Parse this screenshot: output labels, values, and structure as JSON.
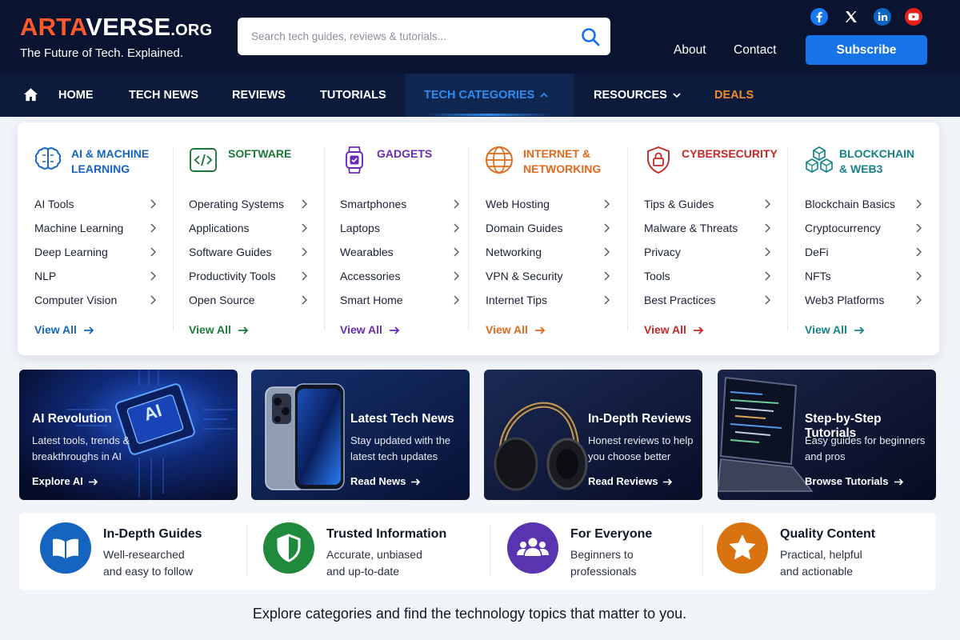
{
  "brand": {
    "name_part1": "ARTA",
    "name_part2": "VERSE",
    "name_suffix": ".ORG",
    "tagline": "The Future of Tech. Explained."
  },
  "search": {
    "placeholder": "Search tech guides, reviews & tutorials..."
  },
  "social": [
    "facebook-icon",
    "x-icon",
    "linkedin-icon",
    "youtube-icon"
  ],
  "header_links": {
    "about": "About",
    "contact": "Contact",
    "subscribe": "Subscribe"
  },
  "nav": {
    "home": "HOME",
    "tech_news": "TECH NEWS",
    "reviews": "REVIEWS",
    "tutorials": "TUTORIALS",
    "tech_categories": "TECH CATEGORIES",
    "resources": "RESOURCES",
    "deals": "DEALS"
  },
  "categories": [
    {
      "title_line1": "AI & MACHINE",
      "title_line2": "LEARNING",
      "color": "#1565c0",
      "items": [
        "AI Tools",
        "Machine Learning",
        "Deep Learning",
        "NLP",
        "Computer Vision"
      ],
      "view_all": "View All"
    },
    {
      "title_line1": "SOFTWARE",
      "title_line2": "",
      "color": "#1b7a3a",
      "items": [
        "Operating Systems",
        "Applications",
        "Software Guides",
        "Productivity Tools",
        "Open Source"
      ],
      "view_all": "View All"
    },
    {
      "title_line1": "GADGETS",
      "title_line2": "",
      "color": "#6a2bb8",
      "items": [
        "Smartphones",
        "Laptops",
        "Wearables",
        "Accessories",
        "Smart Home"
      ],
      "view_all": "View All"
    },
    {
      "title_line1": "INTERNET &",
      "title_line2": "NETWORKING",
      "color": "#e06a1b",
      "items": [
        "Web Hosting",
        "Domain Guides",
        "Networking",
        "VPN & Security",
        "Internet Tips"
      ],
      "view_all": "View All"
    },
    {
      "title_line1": "CYBERSECURITY",
      "title_line2": "",
      "color": "#c62828",
      "items": [
        "Tips & Guides",
        "Malware & Threats",
        "Privacy",
        "Tools",
        "Best Practices"
      ],
      "view_all": "View All"
    },
    {
      "title_line1": "BLOCKCHAIN",
      "title_line2": "& WEB3",
      "color": "#16838a",
      "items": [
        "Blockchain Basics",
        "Cryptocurrency",
        "DeFi",
        "NFTs",
        "Web3 Platforms"
      ],
      "view_all": "View All"
    }
  ],
  "cards": [
    {
      "title": "AI Revolution",
      "desc_line1": "Latest tools, trends &",
      "desc_line2": "breakthroughs in AI",
      "link": "Explore AI",
      "badge": "AI"
    },
    {
      "title": "Latest Tech News",
      "desc_line1": "Stay updated with the",
      "desc_line2": "latest tech updates",
      "link": "Read News"
    },
    {
      "title": "In-Depth Reviews",
      "desc_line1": "Honest reviews to help",
      "desc_line2": "you choose better",
      "link": "Read Reviews"
    },
    {
      "title": "Step-by-Step Tutorials",
      "desc_line1": "Easy guides for beginners",
      "desc_line2": "and pros",
      "link": "Browse Tutorials"
    }
  ],
  "values": [
    {
      "title": "In-Depth Guides",
      "desc_line1": "Well-researched",
      "desc_line2": "and easy to follow",
      "color": "#1565c0"
    },
    {
      "title": "Trusted Information",
      "desc_line1": "Accurate, unbiased",
      "desc_line2": "and up-to-date",
      "color": "#1f8a3b"
    },
    {
      "title": "For Everyone",
      "desc_line1": "Beginners to",
      "desc_line2": "professionals",
      "color": "#5a33b0"
    },
    {
      "title": "Quality Content",
      "desc_line1": "Practical, helpful",
      "desc_line2": "and actionable",
      "color": "#d9730f"
    }
  ],
  "footer": {
    "text": "Explore categories and find the technology topics that matter to you."
  }
}
